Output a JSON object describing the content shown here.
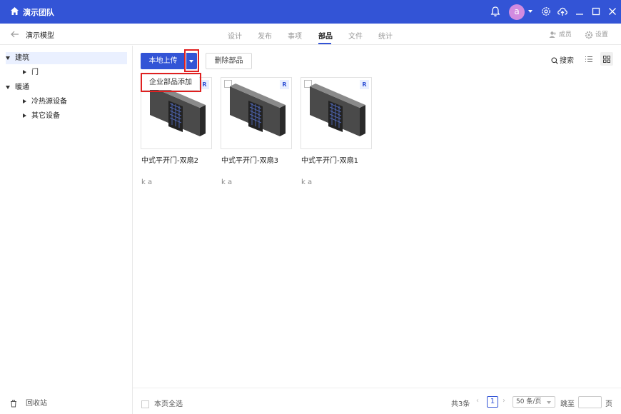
{
  "titlebar": {
    "team_name": "演示团队",
    "avatar_letter": "a",
    "bg_color": "#3354d6"
  },
  "header": {
    "project_name": "演示模型",
    "tabs": [
      {
        "label": "设计"
      },
      {
        "label": "发布"
      },
      {
        "label": "事项"
      },
      {
        "label": "部品",
        "active": true
      },
      {
        "label": "文件"
      },
      {
        "label": "统计"
      }
    ],
    "members_label": "成员",
    "settings_label": "设置"
  },
  "sidebar": {
    "tree": [
      {
        "label": "建筑",
        "expanded": true,
        "selected": true
      },
      {
        "label": "门",
        "expanded": false
      },
      {
        "label": "暖通",
        "expanded": true
      },
      {
        "label": "冷热源设备",
        "expanded": false
      },
      {
        "label": "其它设备",
        "expanded": false
      }
    ],
    "recycle_label": "回收站"
  },
  "toolbar": {
    "upload_label": "本地上传",
    "delete_label": "删除部品",
    "dropdown_item": "企业部品添加",
    "search_label": "搜索"
  },
  "cards": [
    {
      "name": "中式平开门-双扇2",
      "author": "k a",
      "badge": "R"
    },
    {
      "name": "中式平开门-双扇3",
      "author": "k a",
      "badge": "R"
    },
    {
      "name": "中式平开门-双扇1",
      "author": "k a",
      "badge": "R"
    }
  ],
  "footer": {
    "select_all_label": "本页全选",
    "total_label": "共3条",
    "current_page": "1",
    "page_size_label": "50 条/页",
    "jump_label": "跳至",
    "page_suffix": "页"
  }
}
